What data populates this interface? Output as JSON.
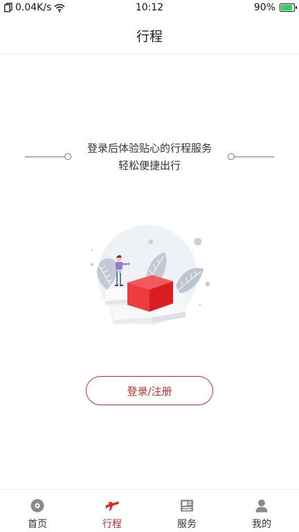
{
  "status_bar": {
    "network_speed": "0.04K/s",
    "time": "10:12",
    "battery_percent": "90%",
    "battery_level": 0.9
  },
  "header": {
    "title": "行程"
  },
  "main": {
    "tagline_line1": "登录后体验贴心的行程服务",
    "tagline_line2": "轻松便捷出行",
    "login_button_label": "登录/注册"
  },
  "tab_bar": {
    "tabs": [
      {
        "label": "首页",
        "icon": "home-disc-icon",
        "active": false
      },
      {
        "label": "行程",
        "icon": "airplane-icon",
        "active": true
      },
      {
        "label": "服务",
        "icon": "newspaper-icon",
        "active": false
      },
      {
        "label": "我的",
        "icon": "person-icon",
        "active": false
      }
    ]
  },
  "colors": {
    "accent": "#e0262b",
    "battery_green": "#2fd15b",
    "inactive_icon": "#8a8a8a"
  }
}
